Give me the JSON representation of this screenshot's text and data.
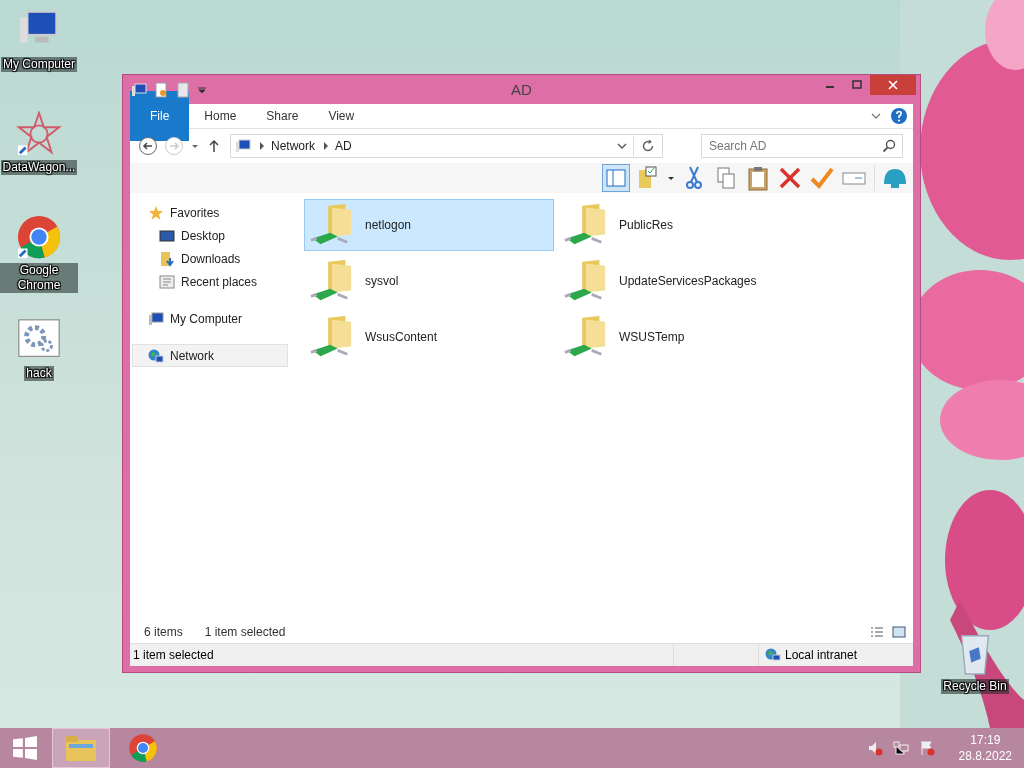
{
  "desktop_icons": [
    {
      "label": "My Computer",
      "kind": "computer"
    },
    {
      "label": "DataWagon...",
      "kind": "star"
    },
    {
      "label": "Google Chrome",
      "kind": "chrome"
    },
    {
      "label": "hack",
      "kind": "gear"
    }
  ],
  "recycle_bin": {
    "label": "Recycle Bin"
  },
  "window": {
    "title": "AD"
  },
  "ribbon_tabs": [
    {
      "label": "File",
      "kind": "file"
    },
    {
      "label": "Home",
      "kind": "tab",
      "selected": false
    },
    {
      "label": "Share",
      "kind": "tab",
      "selected": false
    },
    {
      "label": "View",
      "kind": "tab",
      "selected": false
    }
  ],
  "address": {
    "path": [
      "Network",
      "AD"
    ]
  },
  "search": {
    "placeholder": "Search AD"
  },
  "nav": [
    {
      "label": "Favorites",
      "kind": "star",
      "selected": false,
      "children": [
        {
          "label": "Desktop",
          "kind": "desktop",
          "selected": false
        },
        {
          "label": "Downloads",
          "kind": "downloads",
          "selected": false
        },
        {
          "label": "Recent places",
          "kind": "recent",
          "selected": false
        }
      ]
    },
    {
      "label": "My Computer",
      "kind": "computer",
      "selected": false
    },
    {
      "label": "Network",
      "kind": "network",
      "selected": true
    }
  ],
  "items": [
    {
      "name": "netlogon",
      "selected": true
    },
    {
      "name": "PublicRes",
      "selected": false
    },
    {
      "name": "sysvol",
      "selected": false
    },
    {
      "name": "UpdateServicesPackages",
      "selected": false
    },
    {
      "name": "WsusContent",
      "selected": false
    },
    {
      "name": "WSUSTemp",
      "selected": false
    }
  ],
  "info": {
    "count": "6 items",
    "selection": "1 item selected"
  },
  "status_bar": {
    "text": "1 item selected",
    "zone": "Local intranet"
  },
  "taskbar": {
    "apps": [
      {
        "kind": "explorer",
        "selected": true
      },
      {
        "kind": "chrome",
        "selected": false
      }
    ],
    "time": "17:19",
    "date": "28.8.2022"
  }
}
